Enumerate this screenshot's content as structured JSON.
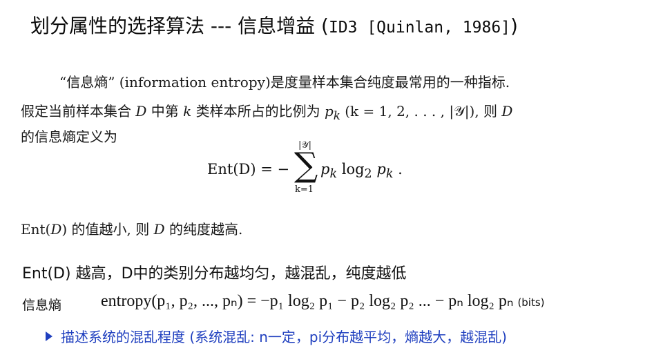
{
  "title": {
    "main": "划分属性的选择算法 --- 信息增益 (",
    "ref": "ID3 [Quinlan, 1986]",
    "close": ")"
  },
  "paragraph": {
    "line1": "“信息熵” (information entropy)是度量样本集合纯度最常用的一种指标.",
    "line2_a": "假定当前样本集合 ",
    "var_D": "D",
    "line2_b": " 中第 ",
    "var_k": "k",
    "line2_c": " 类样本所占的比例为 ",
    "var_pk": "p",
    "sub_k": "k",
    "line2_d": " (k = 1, 2, . . . , |𝒴|), 则 ",
    "line3": "的信息熵定义为"
  },
  "formula": {
    "lhs": "Ent(D) = −",
    "sigma": "∑",
    "upper": "|𝒴|",
    "lower": "k=1",
    "rhs": "p",
    "rhs_sub": "k",
    "rhs_log": " log",
    "rhs_log_sub": "2",
    "rhs_p2": " p",
    "rhs_p2_sub": "k",
    "rhs_end": " ."
  },
  "conclusion": {
    "a": "Ent(",
    "D": "D",
    "b": ") 的值越小, 则 ",
    "c": " 的纯度越高."
  },
  "note": "Ent(D) 越高，D中的类别分布越均匀，越混乱，纯度越低",
  "entropy_label": "信息熵",
  "entropy_formula": {
    "text": "entropy(p₁, p₂, ..., pₙ) = −p₁ log₂ p₁ − p₂ log₂ p₂ ... − pₙ log₂ pₙ",
    "units": "(bits)"
  },
  "bullet": "描述系统的混乱程度 (系统混乱: n一定，pi分布越平均，熵越大，越混乱)",
  "colors": {
    "bullet": "#1f3fbf",
    "text": "#111111"
  }
}
